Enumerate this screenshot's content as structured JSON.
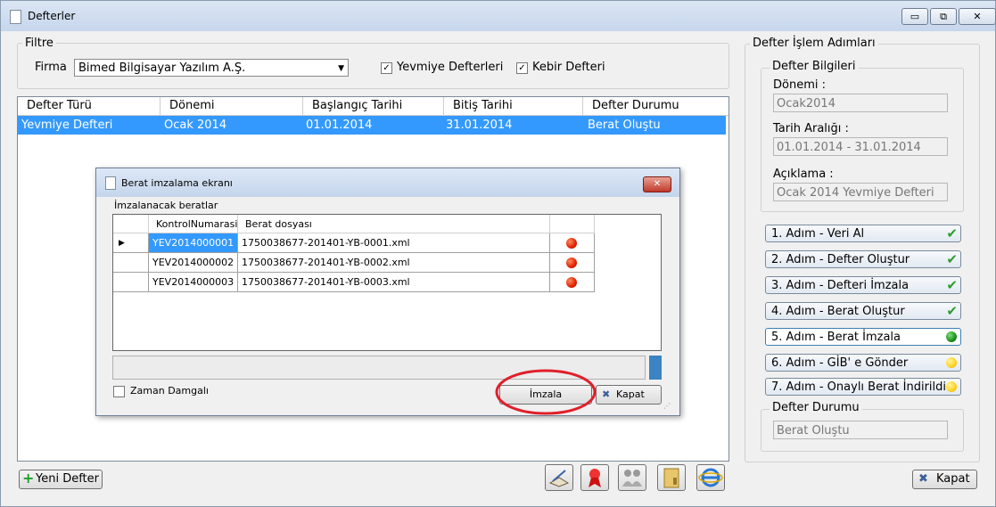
{
  "window": {
    "title": "Defterler",
    "min": "▭",
    "max": "⧉",
    "close": "✕"
  },
  "filter": {
    "legend": "Filtre",
    "firma_label": "Firma",
    "firma_value": "Bimed Bilgisayar Yazılım A.Ş.",
    "yevmiye_label": "Yevmiye Defterleri",
    "kebir_label": "Kebir Defteri",
    "check_mark": "✓"
  },
  "grid": {
    "columns": [
      "Defter Türü",
      "Dönemi",
      "Başlangıç Tarihi",
      "Bitiş Tarihi",
      "Defter Durumu"
    ],
    "rows": [
      [
        "Yevmiye Defteri",
        "Ocak 2014",
        "01.01.2014",
        "31.01.2014",
        "Berat Oluştu"
      ]
    ]
  },
  "dialog": {
    "title": "Berat imzalama ekranı",
    "close": "✕",
    "section_label": "İmzalanacak beratlar",
    "columns": [
      "KontrolNumarasi",
      "Berat dosyası"
    ],
    "rows": [
      [
        "YEV2014000001",
        "1750038677-201401-YB-0001.xml"
      ],
      [
        "YEV2014000002",
        "1750038677-201401-YB-0002.xml"
      ],
      [
        "YEV2014000003",
        "1750038677-201401-YB-0003.xml"
      ]
    ],
    "row_pointer": "▶",
    "timestamp_label": "Zaman Damgalı",
    "sign_button": "İmzala",
    "close_button": "Kapat",
    "highlight_color": "#e0202a"
  },
  "steps_panel": {
    "legend": "Defter İşlem Adımları",
    "info_legend": "Defter Bilgileri",
    "donemi_label": "Dönemi :",
    "donemi_value": "Ocak2014",
    "tarih_label": "Tarih Aralığı :",
    "tarih_value": "01.01.2014 - 31.01.2014",
    "aciklama_label": "Açıklama :",
    "aciklama_value": "Ocak 2014 Yevmiye Defteri",
    "steps": [
      {
        "label": "1. Adım - Veri Al",
        "status": "done"
      },
      {
        "label": "2. Adım - Defter Oluştur",
        "status": "done"
      },
      {
        "label": "3. Adım - Defteri İmzala",
        "status": "done"
      },
      {
        "label": "4. Adım - Berat Oluştur",
        "status": "done"
      },
      {
        "label": "5. Adım - Berat İmzala",
        "status": "active"
      },
      {
        "label": "6. Adım - GİB' e Gönder",
        "status": "pending"
      },
      {
        "label": "7. Adım - Onaylı Berat İndirildi",
        "status": "pending"
      }
    ],
    "done_mark": "✔",
    "durum_legend": "Defter Durumu",
    "durum_value": "Berat Oluştu"
  },
  "footer": {
    "new_button": "Yeni Defter",
    "close_button": "Kapat",
    "plus_icon": "+",
    "toolbar_icons": [
      "book-sign-icon",
      "ribbon-award-icon",
      "users-icon",
      "folder-icon",
      "internet-explorer-icon"
    ]
  },
  "colors": {
    "selection": "#3399ff",
    "step_active_dot": "#1a8f1a",
    "step_pending_dot": "#ffd21f",
    "check_green": "#2e9e2e"
  }
}
